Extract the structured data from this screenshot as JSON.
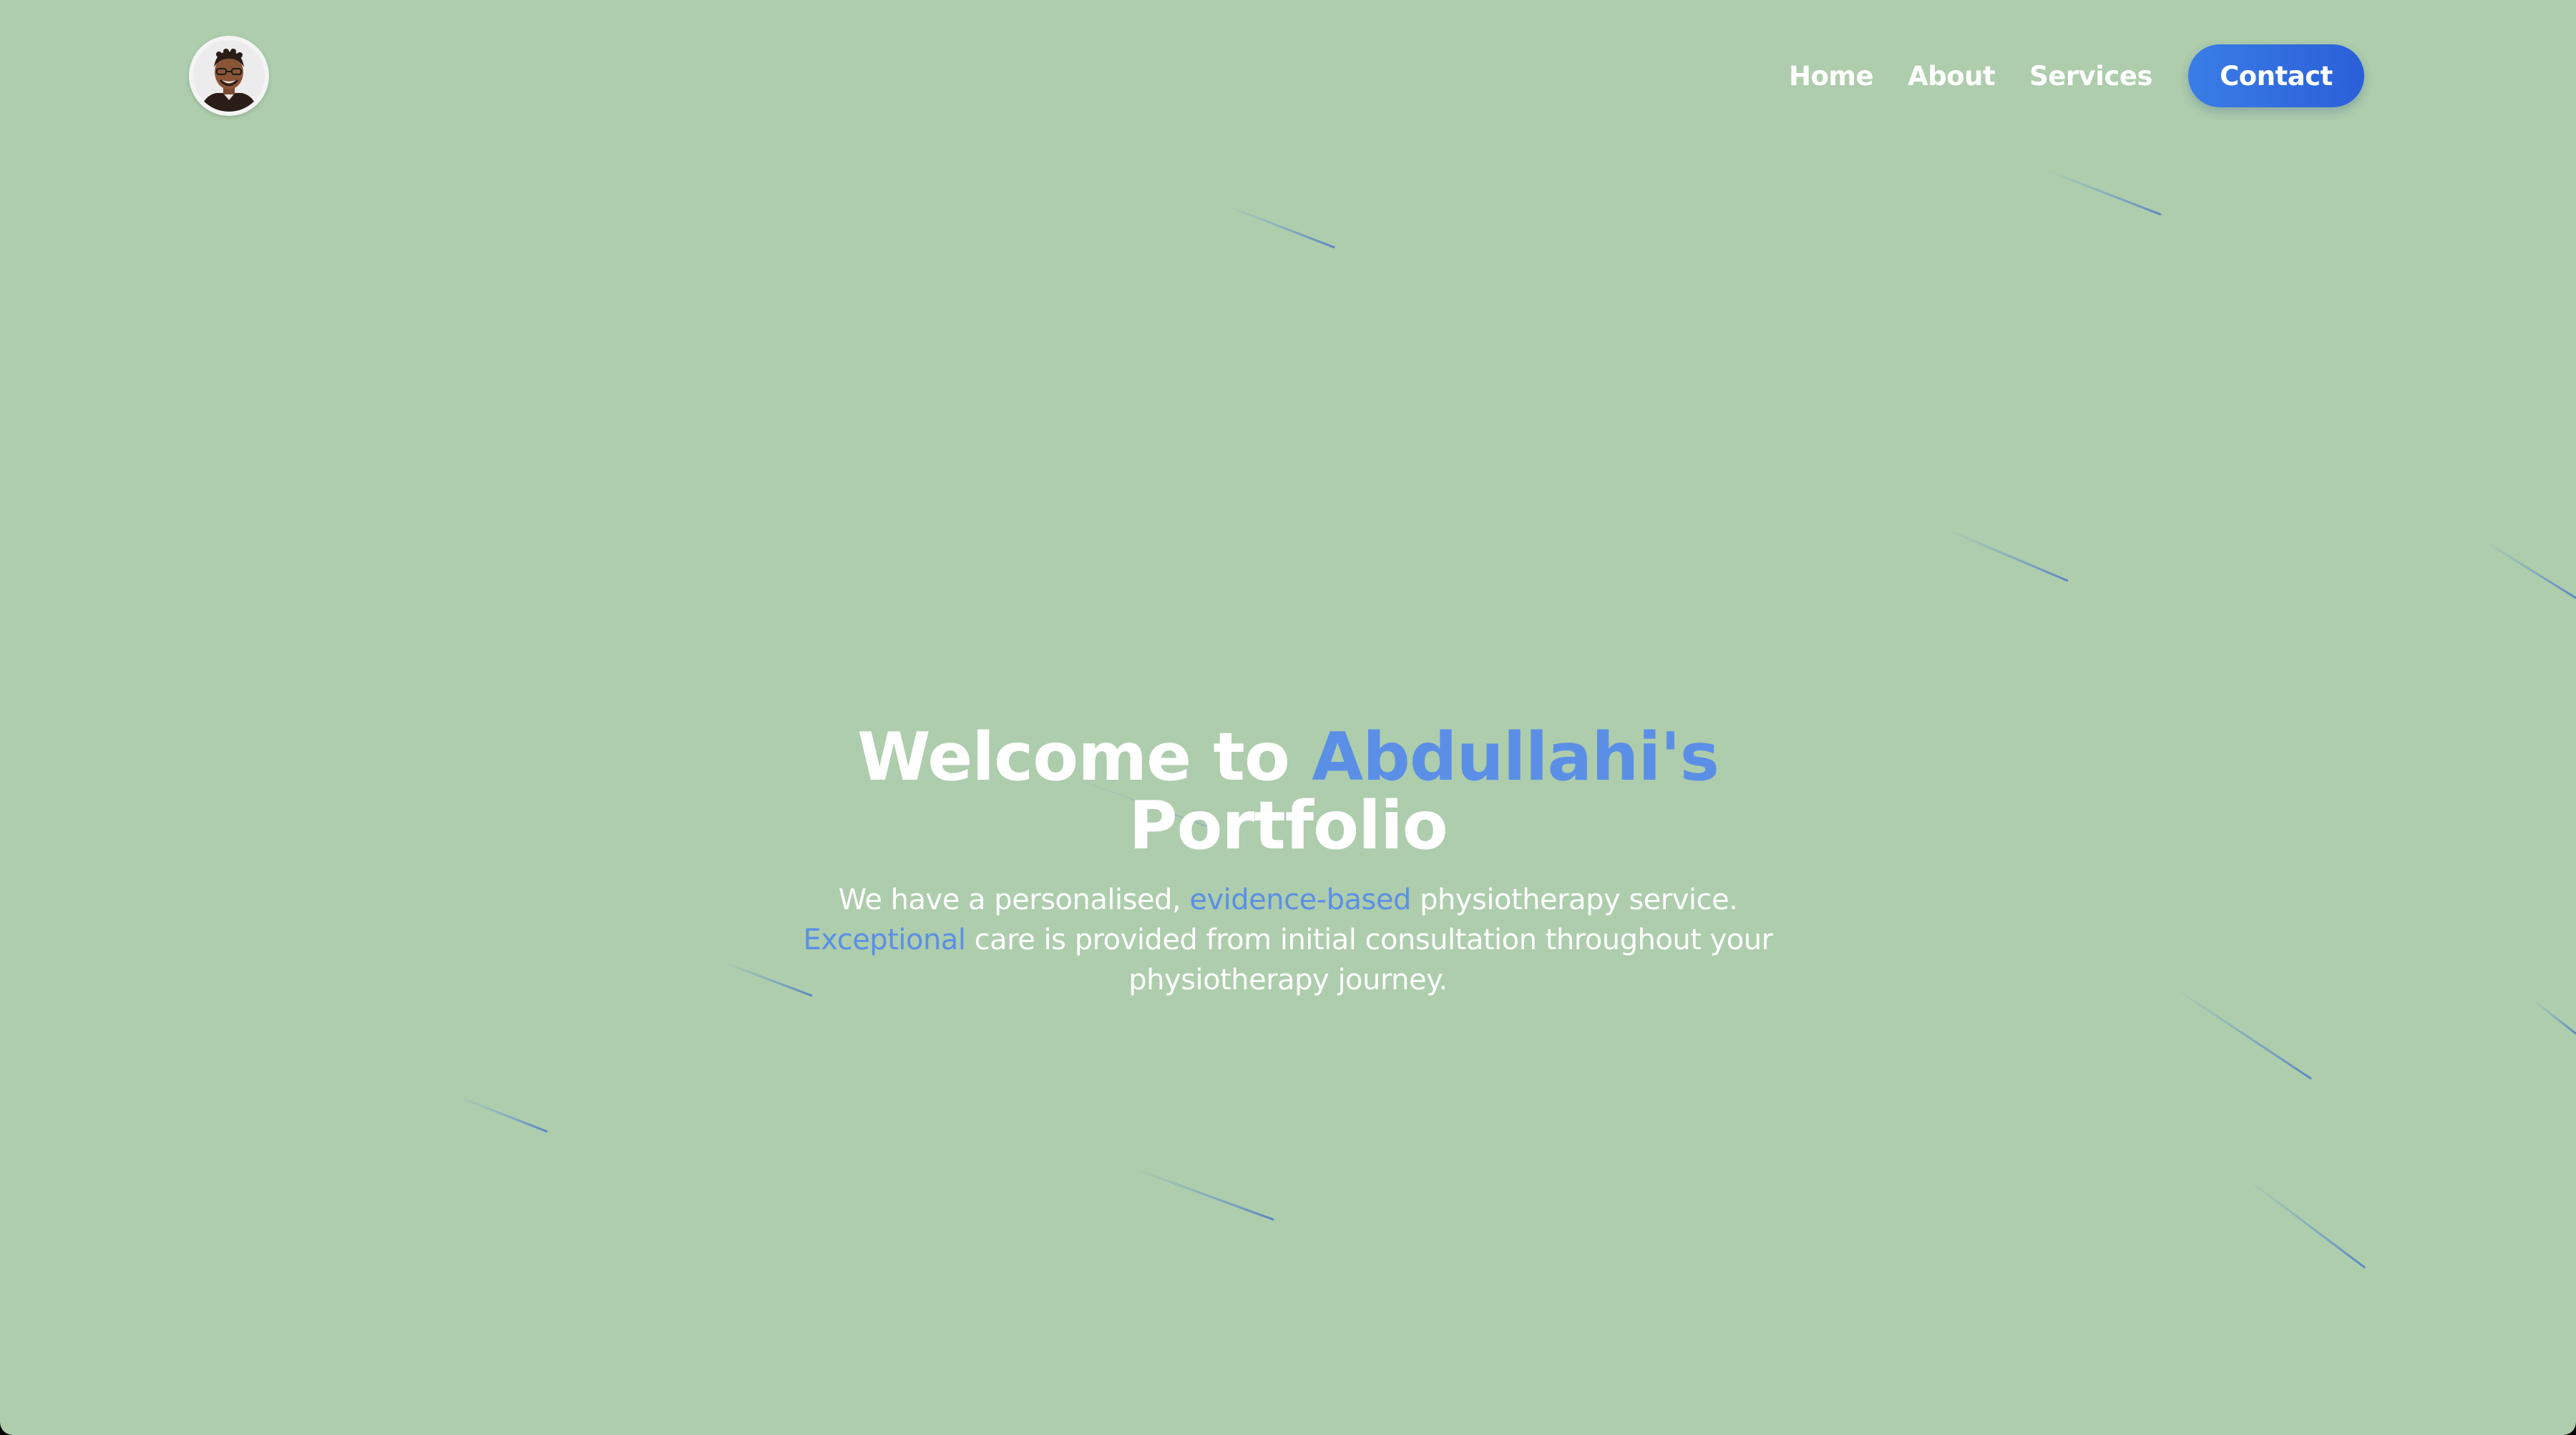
{
  "page": {
    "background": "#adcdac",
    "accent": "#5b8fe6"
  },
  "nav": {
    "logo_icon": "avatar-portrait",
    "links": [
      "Home",
      "About",
      "Services"
    ],
    "contact_label": "Contact",
    "contact_color": "#2f6ae0"
  },
  "hero": {
    "title_part1": "Welcome to ",
    "title_accent": "Abdullahi's",
    "title_part2": "Portfolio",
    "text_part1": "We have a personalised, ",
    "text_accent1": "evidence-based",
    "text_part2": " physiotherapy service.",
    "text_accent2": "Exceptional",
    "text_part3": " care is provided from initial consultation throughout your physiotherapy journey."
  }
}
